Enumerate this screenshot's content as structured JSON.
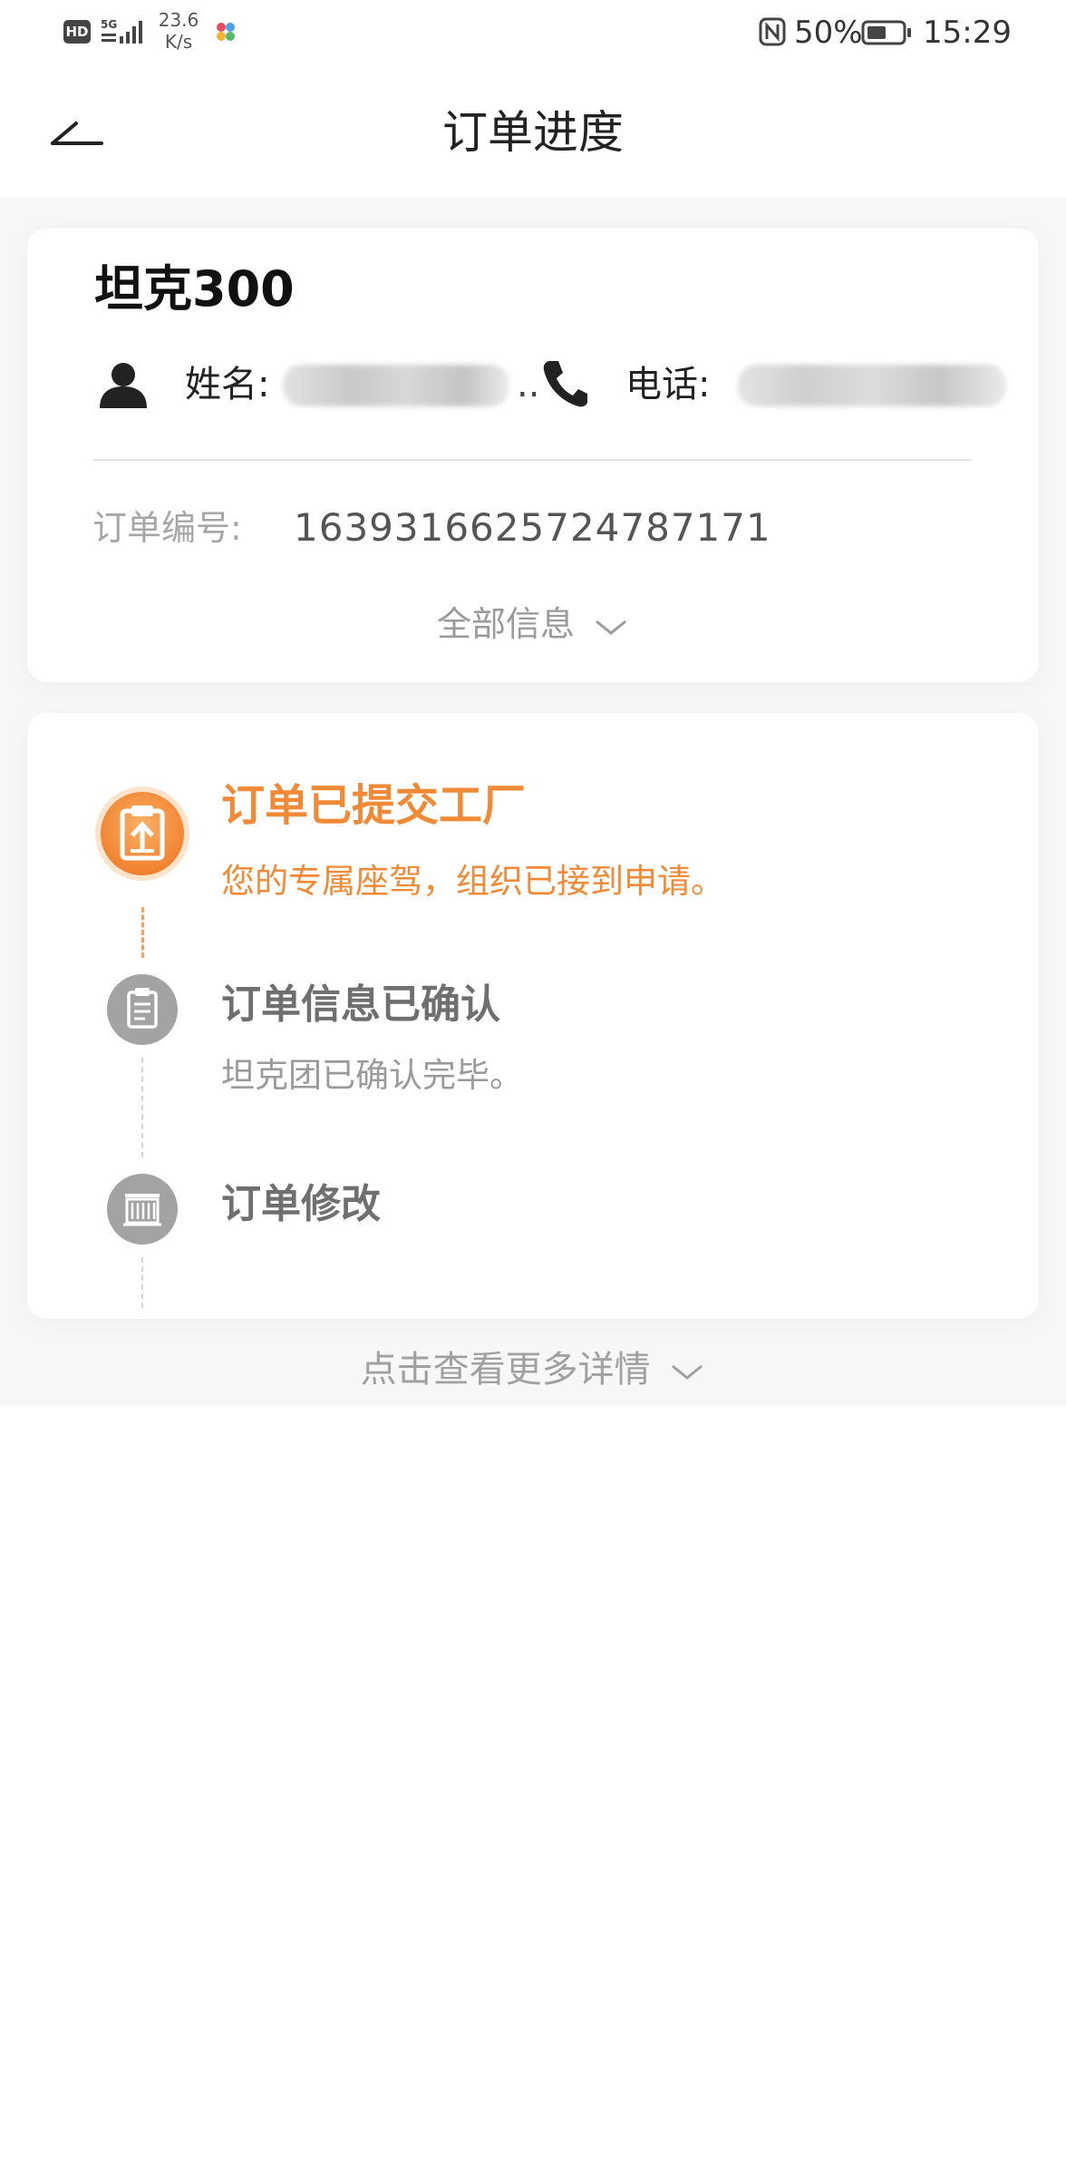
{
  "status_bar": {
    "network_badge": "HD",
    "network_type": "5G",
    "speed_value": "23.6",
    "speed_unit": "K/s",
    "battery_percent": "50%",
    "time": "15:29"
  },
  "header": {
    "title": "订单进度"
  },
  "order_card": {
    "car_name": "坦克300",
    "name_label": "姓名:",
    "name_truncation": "..",
    "phone_label": "电话:",
    "order_number_label": "订单编号:",
    "order_number": "1639316625724787171",
    "all_info_label": "全部信息"
  },
  "progress": {
    "steps": [
      {
        "title": "订单已提交工厂",
        "description": "您的专属座驾，组织已接到申请。",
        "status": "active"
      },
      {
        "title": "订单信息已确认",
        "description": "坦克团已确认完毕。",
        "status": "done"
      },
      {
        "title": "订单修改",
        "description": "",
        "status": "pending"
      }
    ],
    "more_details_label": "点击查看更多详情"
  },
  "colors": {
    "accent": "#f08a36",
    "inactive_icon": "#a3a3a3",
    "background": "#f7f7f8"
  }
}
